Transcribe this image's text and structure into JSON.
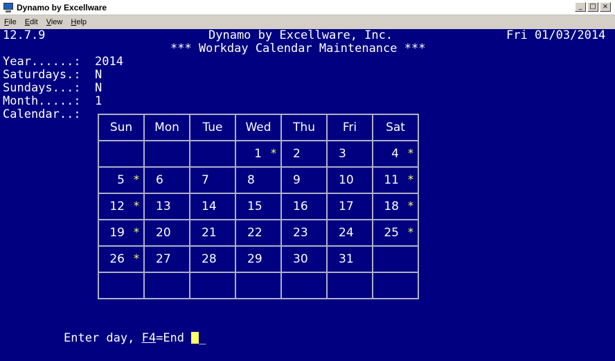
{
  "window": {
    "title": "Dynamo by Excellware",
    "buttons": {
      "minimize": "_",
      "maximize": "□",
      "close": "×"
    }
  },
  "menu": {
    "items": [
      {
        "key": "F",
        "rest": "ile"
      },
      {
        "key": "E",
        "rest": "dit"
      },
      {
        "key": "V",
        "rest": "iew"
      },
      {
        "key": "H",
        "rest": "elp"
      }
    ]
  },
  "header": {
    "version": "12.7.9",
    "company": "Dynamo by Excellware, Inc.",
    "date": "Fri 01/03/2014",
    "screen_title": "*** Workday Calendar Maintenance ***"
  },
  "fields": {
    "year_label": "Year......:",
    "year_value": "2014",
    "saturdays_label": "Saturdays.:",
    "saturdays_value": "N",
    "sundays_label": "Sundays...:",
    "sundays_value": "N",
    "month_label": "Month.....:",
    "month_value": "1",
    "calendar_label": "Calendar..:"
  },
  "calendar": {
    "days": [
      "Sun",
      "Mon",
      "Tue",
      "Wed",
      "Thu",
      "Fri",
      "Sat"
    ],
    "weeks": [
      [
        {
          "d": "",
          "s": ""
        },
        {
          "d": "",
          "s": ""
        },
        {
          "d": "",
          "s": ""
        },
        {
          "d": "1",
          "s": "*"
        },
        {
          "d": "2",
          "s": ""
        },
        {
          "d": "3",
          "s": ""
        },
        {
          "d": "4",
          "s": "*"
        }
      ],
      [
        {
          "d": "5",
          "s": "*"
        },
        {
          "d": "6",
          "s": ""
        },
        {
          "d": "7",
          "s": ""
        },
        {
          "d": "8",
          "s": ""
        },
        {
          "d": "9",
          "s": ""
        },
        {
          "d": "10",
          "s": ""
        },
        {
          "d": "11",
          "s": "*"
        }
      ],
      [
        {
          "d": "12",
          "s": "*"
        },
        {
          "d": "13",
          "s": ""
        },
        {
          "d": "14",
          "s": ""
        },
        {
          "d": "15",
          "s": ""
        },
        {
          "d": "16",
          "s": ""
        },
        {
          "d": "17",
          "s": ""
        },
        {
          "d": "18",
          "s": "*"
        }
      ],
      [
        {
          "d": "19",
          "s": "*"
        },
        {
          "d": "20",
          "s": ""
        },
        {
          "d": "21",
          "s": ""
        },
        {
          "d": "22",
          "s": ""
        },
        {
          "d": "23",
          "s": ""
        },
        {
          "d": "24",
          "s": ""
        },
        {
          "d": "25",
          "s": "*"
        }
      ],
      [
        {
          "d": "26",
          "s": "*"
        },
        {
          "d": "27",
          "s": ""
        },
        {
          "d": "28",
          "s": ""
        },
        {
          "d": "29",
          "s": ""
        },
        {
          "d": "30",
          "s": ""
        },
        {
          "d": "31",
          "s": ""
        },
        {
          "d": "",
          "s": ""
        }
      ],
      [
        {
          "d": "",
          "s": ""
        },
        {
          "d": "",
          "s": ""
        },
        {
          "d": "",
          "s": ""
        },
        {
          "d": "",
          "s": ""
        },
        {
          "d": "",
          "s": ""
        },
        {
          "d": "",
          "s": ""
        },
        {
          "d": "",
          "s": ""
        }
      ]
    ]
  },
  "prompt": {
    "prefix": "Enter day, ",
    "key": "F4",
    "suffix": "=End "
  },
  "colors": {
    "background": "#000080",
    "text": "#ffffff",
    "highlight": "#ffff66",
    "grid": "#b0b0c8"
  }
}
